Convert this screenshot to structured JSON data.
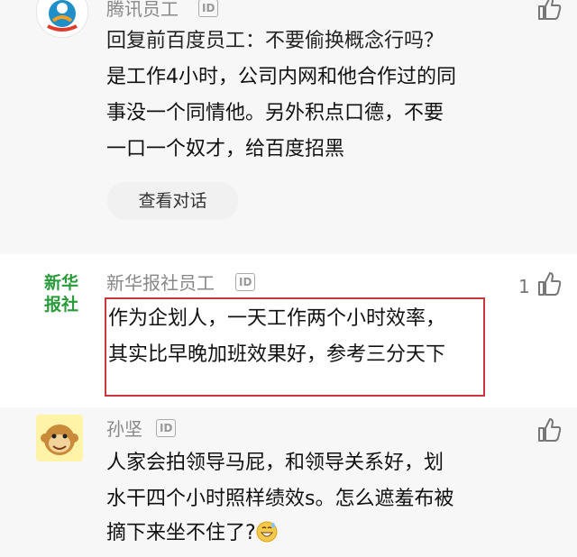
{
  "colors": {
    "highlight_border": "#c8383d",
    "band_bg": "#f7f7f7"
  },
  "comment1": {
    "username": "腾讯员工",
    "id_badge": "ID",
    "text_lines": [
      "回复前百度员工：不要偷换概念行吗？",
      "是工作4小时，公司内网和他合作过的同",
      "事没一个同情他。另外积点口德，不要",
      "一口一个奴才，给百度招黑"
    ],
    "view_dialog_button": "查看对话",
    "avatar_icon": "tencent-logo-icon"
  },
  "comment2": {
    "avatar_text_line1": "新华",
    "avatar_text_line2": "报社",
    "username": "新华报社员工",
    "id_badge": "ID",
    "like_count": "1",
    "text_lines": [
      "作为企划人，一天工作两个小时效率，",
      "其实比早晚加班效果好，参考三分天下"
    ]
  },
  "comment3": {
    "username": "孙坚",
    "id_badge": "ID",
    "avatar_icon": "monkey-face-icon",
    "text_lines": [
      "人家会拍领导马屁，和领导关系好，划",
      "水干四个小时照样绩效s。怎么遮羞布被",
      "摘下来坐不住了?"
    ],
    "emoji_icon": "grinning-sweat-emoji-icon"
  }
}
